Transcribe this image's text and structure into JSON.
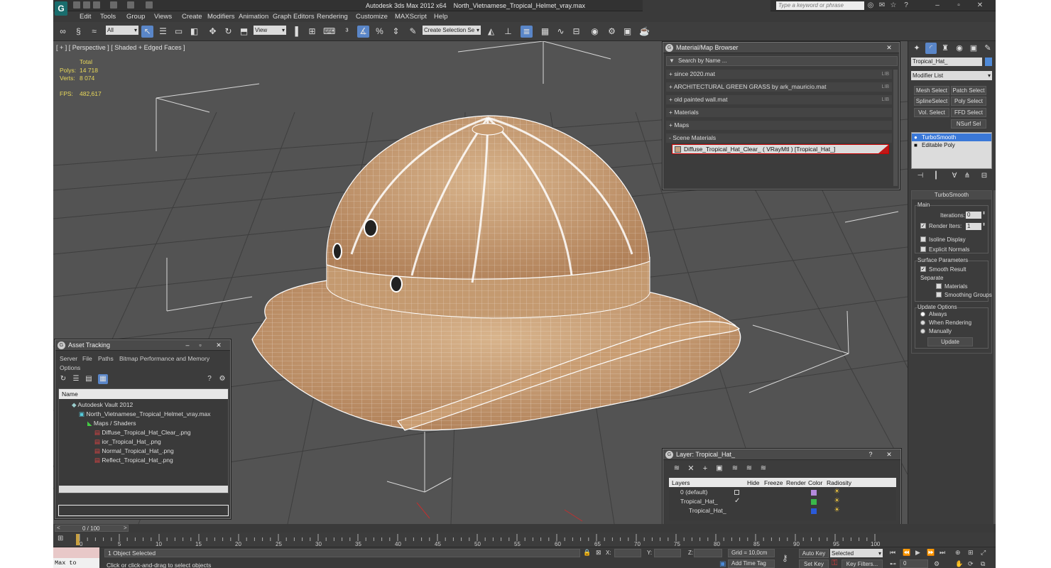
{
  "titlebar": {
    "app_title": "Autodesk 3ds Max  2012 x64",
    "file_name": "North_Vietnamese_Tropical_Helmet_vray.max",
    "search_placeholder": "Type a keyword or phrase"
  },
  "menu": [
    "Edit",
    "Tools",
    "Group",
    "Views",
    "Create",
    "Modifiers",
    "Animation",
    "Graph Editors",
    "Rendering",
    "Customize",
    "MAXScript",
    "Help"
  ],
  "toolbar": {
    "filter_value": "All",
    "refcoord_value": "View",
    "selection_set_value": "Create Selection Se"
  },
  "viewport": {
    "label": "[ + ] [ Perspective ] [ Shaded + Edged Faces ]",
    "stats": {
      "total_label": "Total",
      "polys_label": "Polys:",
      "polys_value": "14 718",
      "verts_label": "Verts:",
      "verts_value": "8 074",
      "fps_label": "FPS:",
      "fps_value": "482,617"
    }
  },
  "material_browser": {
    "title": "Material/Map Browser",
    "search_placeholder": "Search by Name ...",
    "libraries": [
      {
        "label": "+ since 2020.mat",
        "tag": "LIB"
      },
      {
        "label": "+ ARCHITECTURAL GREEN GRASS by ark_mauricio.mat",
        "tag": "LIB"
      },
      {
        "label": "+ old painted wall.mat",
        "tag": "LIB"
      },
      {
        "label": "+ Materials",
        "tag": ""
      },
      {
        "label": "+ Maps",
        "tag": ""
      },
      {
        "label": "- Scene Materials",
        "tag": ""
      }
    ],
    "scene_material": "Diffuse_Tropical_Hat_Clear_  ( VRayMtl )  [Tropical_Hat_]"
  },
  "asset_tracking": {
    "title": "Asset Tracking",
    "menu": [
      "Server",
      "File",
      "Paths",
      "Bitmap Performance and Memory",
      "Options"
    ],
    "column_header": "Name",
    "tree": [
      {
        "label": "Autodesk Vault 2012",
        "indent": 0
      },
      {
        "label": "North_Vietnamese_Tropical_Helmet_vray.max",
        "indent": 1
      },
      {
        "label": "Maps / Shaders",
        "indent": 2
      },
      {
        "label": "Diffuse_Tropical_Hat_Clear_.png",
        "indent": 3
      },
      {
        "label": "ior_Tropical_Hat_.png",
        "indent": 3
      },
      {
        "label": "Normal_Tropical_Hat_.png",
        "indent": 3
      },
      {
        "label": "Reflect_Tropical_Hat_.png",
        "indent": 3
      }
    ]
  },
  "layer_window": {
    "title": "Layer: Tropical_Hat_",
    "headers": [
      "Layers",
      "Hide",
      "Freeze",
      "Render",
      "Color",
      "Radiosity"
    ],
    "rows": [
      {
        "name": "0 (default)",
        "color": "#b48adc"
      },
      {
        "name": "Tropical_Hat_",
        "color": "#3ab84a"
      },
      {
        "name": "Tropical_Hat_",
        "color": "#2a5ad8"
      }
    ]
  },
  "command_panel": {
    "object_name": "Tropical_Hat_",
    "modifier_list": "Modifier List",
    "buttons": [
      "Mesh Select",
      "Patch Select",
      "SplineSelect",
      "Poly Select",
      "Vol. Select",
      "FFD Select",
      "NSurf Sel"
    ],
    "stack": [
      "TurboSmooth",
      "Editable Poly"
    ],
    "rollout_title": "TurboSmooth",
    "main_label": "Main",
    "iterations_label": "Iterations:",
    "iterations_value": "0",
    "render_iters_label": "Render Iters:",
    "render_iters_value": "1",
    "isoline_label": "Isoline Display",
    "explicit_label": "Explicit Normals",
    "surface_label": "Surface Parameters",
    "smooth_label": "Smooth Result",
    "separate_label": "Separate",
    "materials_label": "Materials",
    "groups_label": "Smoothing Groups",
    "update_label": "Update Options",
    "always_label": "Always",
    "when_label": "When Rendering",
    "manually_label": "Manually",
    "update_button": "Update"
  },
  "timeline": {
    "frame": "0 / 100",
    "ticks": [
      "0",
      "5",
      "10",
      "15",
      "20",
      "25",
      "30",
      "35",
      "40",
      "45",
      "50",
      "55",
      "60",
      "65",
      "70",
      "75",
      "80",
      "85",
      "90",
      "95",
      "100"
    ]
  },
  "statusbar": {
    "maxscript": "Max to Physc.",
    "selected": "1 Object Selected",
    "prompt": "Click or click-and-drag to select objects",
    "x_label": "X:",
    "y_label": "Y:",
    "z_label": "Z:",
    "grid": "Grid = 10,0cm",
    "add_time_tag": "Add Time Tag",
    "auto_key": "Auto Key",
    "set_key": "Set Key",
    "selected_dd": "Selected",
    "key_filters": "Key Filters...",
    "frame_value": "0"
  }
}
